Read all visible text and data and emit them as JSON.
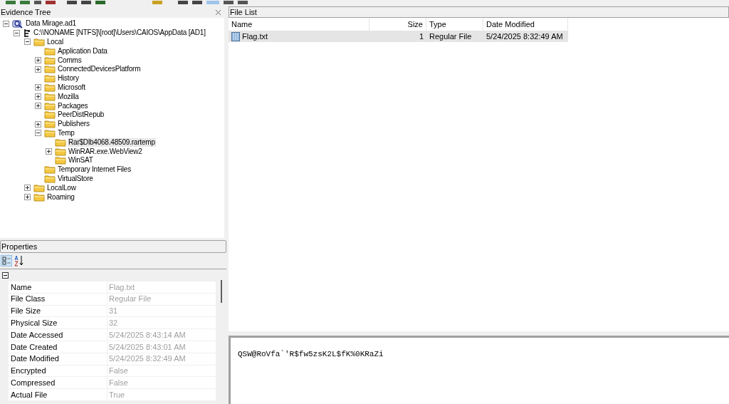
{
  "evidence_tree": {
    "title": "Evidence Tree",
    "items": [
      {
        "label": "Data Mirage.ad1",
        "kind": "image",
        "expanded": true,
        "selected": false,
        "children": [
          {
            "label": "C:\\\\NONAME [NTFS]\\[root]\\Users\\CAIOS\\AppData [AD1]",
            "kind": "drive",
            "expanded": true,
            "selected": false,
            "children": [
              {
                "label": "Local",
                "kind": "folder",
                "expanded": true,
                "selected": false,
                "children": [
                  {
                    "label": "Application Data",
                    "kind": "folder",
                    "selected": false
                  },
                  {
                    "label": "Comms",
                    "kind": "folder",
                    "expanded": false,
                    "selected": false
                  },
                  {
                    "label": "ConnectedDevicesPlatform",
                    "kind": "folder",
                    "expanded": false,
                    "selected": false
                  },
                  {
                    "label": "History",
                    "kind": "folder",
                    "selected": false
                  },
                  {
                    "label": "Microsoft",
                    "kind": "folder",
                    "expanded": false,
                    "selected": false
                  },
                  {
                    "label": "Mozilla",
                    "kind": "folder",
                    "expanded": false,
                    "selected": false
                  },
                  {
                    "label": "Packages",
                    "kind": "folder",
                    "expanded": false,
                    "selected": false
                  },
                  {
                    "label": "PeerDistRepub",
                    "kind": "folder",
                    "selected": false
                  },
                  {
                    "label": "Publishers",
                    "kind": "folder",
                    "expanded": false,
                    "selected": false
                  },
                  {
                    "label": "Temp",
                    "kind": "folder",
                    "expanded": true,
                    "selected": false,
                    "children": [
                      {
                        "label": "Rar$Dlb4068.48509.rartemp",
                        "kind": "folder",
                        "selected": true
                      },
                      {
                        "label": "WinRAR.exe.WebView2",
                        "kind": "folder",
                        "expanded": false,
                        "selected": false
                      },
                      {
                        "label": "WinSAT",
                        "kind": "folder",
                        "selected": false
                      }
                    ]
                  },
                  {
                    "label": "Temporary Internet Files",
                    "kind": "folder",
                    "selected": false
                  },
                  {
                    "label": "VirtualStore",
                    "kind": "folder",
                    "selected": false
                  }
                ]
              },
              {
                "label": "LocalLow",
                "kind": "folder",
                "expanded": false,
                "selected": false
              },
              {
                "label": "Roaming",
                "kind": "folder",
                "expanded": false,
                "selected": false
              }
            ]
          }
        ]
      }
    ]
  },
  "properties": {
    "title": "Properties",
    "rows": [
      {
        "name": "Name",
        "value": "Flag.txt"
      },
      {
        "name": "File Class",
        "value": "Regular File"
      },
      {
        "name": "File Size",
        "value": "31"
      },
      {
        "name": "Physical Size",
        "value": "32"
      },
      {
        "name": "Date Accessed",
        "value": "5/24/2025 8:43:14 AM"
      },
      {
        "name": "Date Created",
        "value": "5/24/2025 8:43:01 AM"
      },
      {
        "name": "Date Modified",
        "value": "5/24/2025 8:32:49 AM"
      },
      {
        "name": "Encrypted",
        "value": "False"
      },
      {
        "name": "Compressed",
        "value": "False"
      },
      {
        "name": "Actual File",
        "value": "True"
      }
    ]
  },
  "file_list": {
    "title": "File List",
    "columns": [
      "Name",
      "Size",
      "Type",
      "Date Modified"
    ],
    "rows": [
      {
        "name": "Flag.txt",
        "size": "1",
        "type": "Regular File",
        "date_modified": "5/24/2025 8:32:49 AM",
        "selected": true
      }
    ]
  },
  "text_viewer": {
    "content": "QSW@RoVfa`'R$fw5zsK2L$fK%0KRaZi"
  }
}
